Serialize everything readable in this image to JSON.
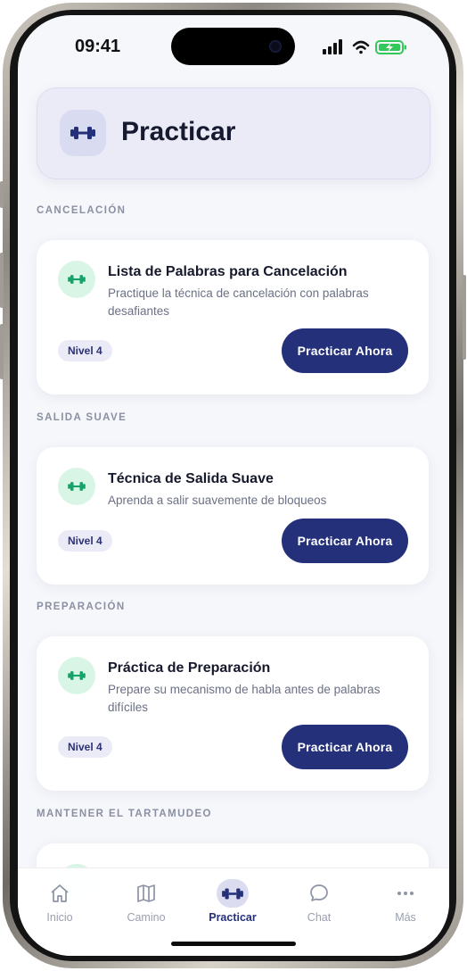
{
  "status": {
    "time": "09:41"
  },
  "header": {
    "title": "Practicar",
    "icon": "dumbbell-icon"
  },
  "sections": [
    {
      "label": "CANCELACIÓN",
      "card": {
        "title": "Lista de Palabras para Cancelación",
        "description": "Practique la técnica de cancelación con palabras desafiantes",
        "level": "Nivel 4",
        "button": "Practicar Ahora"
      }
    },
    {
      "label": "SALIDA SUAVE",
      "card": {
        "title": "Técnica de Salida Suave",
        "description": "Aprenda a salir suavemente de bloqueos",
        "level": "Nivel 4",
        "button": "Practicar Ahora"
      }
    },
    {
      "label": "PREPARACIÓN",
      "card": {
        "title": "Práctica de Preparación",
        "description": "Prepare su mecanismo de habla antes de palabras difíciles",
        "level": "Nivel 4",
        "button": "Practicar Ahora"
      }
    },
    {
      "label": "MANTENER EL TARTAMUDEO"
    }
  ],
  "tabs": [
    {
      "label": "Inicio",
      "icon": "home-icon",
      "active": false
    },
    {
      "label": "Camino",
      "icon": "map-icon",
      "active": false
    },
    {
      "label": "Practicar",
      "icon": "dumbbell-icon",
      "active": true
    },
    {
      "label": "Chat",
      "icon": "chat-bubble-icon",
      "active": false
    },
    {
      "label": "Más",
      "icon": "more-dots-icon",
      "active": false
    }
  ],
  "colors": {
    "primary": "#24307a",
    "accent_green": "#16a26b",
    "header_bg": "#ebebf7",
    "screen_bg": "#f6f7fb"
  }
}
